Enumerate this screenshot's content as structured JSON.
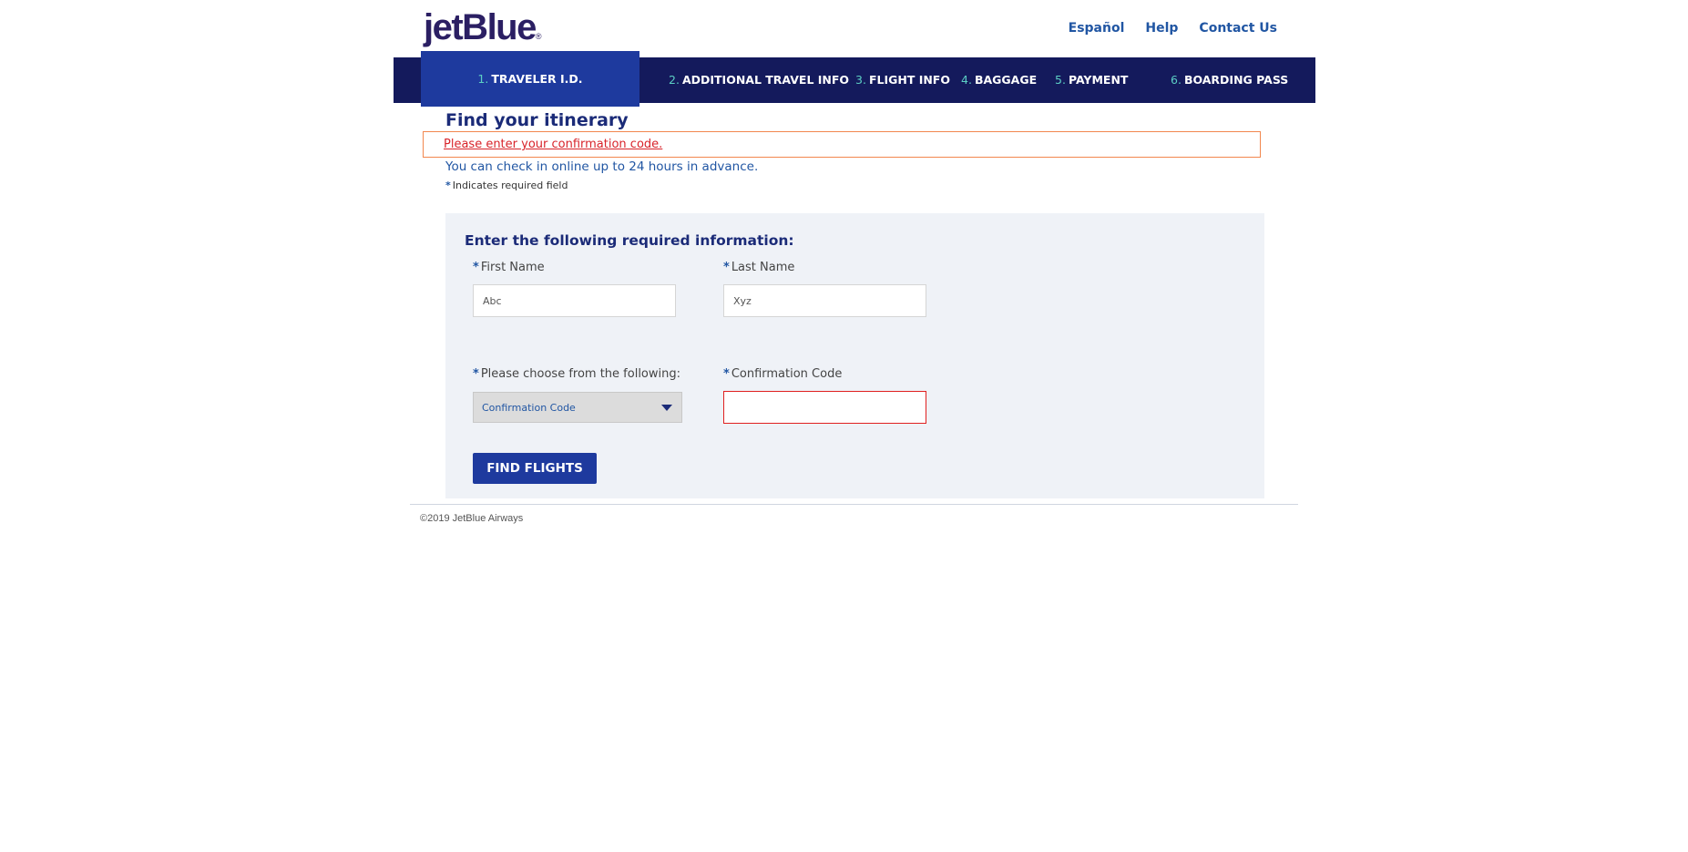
{
  "header": {
    "logo_text": "jetBlue",
    "links": [
      "Español",
      "Help",
      "Contact Us"
    ]
  },
  "nav": {
    "steps": [
      {
        "num": "1.",
        "label": "TRAVELER I.D.",
        "active": true
      },
      {
        "num": "2.",
        "label": "ADDITIONAL TRAVEL INFO",
        "active": false
      },
      {
        "num": "3.",
        "label": "FLIGHT INFO",
        "active": false
      },
      {
        "num": "4.",
        "label": "BAGGAGE",
        "active": false
      },
      {
        "num": "5.",
        "label": "PAYMENT",
        "active": false
      },
      {
        "num": "6.",
        "label": "BOARDING PASS",
        "active": false
      }
    ]
  },
  "main": {
    "title": "Find your itinerary",
    "error": "Please enter your confirmation code.",
    "info": "You can check in online up to 24 hours in advance.",
    "required_note": "Indicates required field",
    "required_marker": "*"
  },
  "form": {
    "heading": "Enter the following required information:",
    "first_name_label": "First Name",
    "first_name_value": "Abc",
    "last_name_label": "Last Name",
    "last_name_value": "Xyz",
    "choose_label": "Please choose from the following:",
    "choose_value": "Confirmation Code",
    "code_label": "Confirmation Code",
    "code_value": "",
    "submit_label": "FIND FLIGHTS"
  },
  "footer": {
    "copyright": "©2019 JetBlue Airways"
  },
  "colors": {
    "nav_bg": "#141a5c",
    "nav_active": "#1e3a9e",
    "step_number": "#5ccfc4",
    "error": "#d8232a",
    "link": "#2156a3",
    "panel_bg": "#eff2f7"
  }
}
